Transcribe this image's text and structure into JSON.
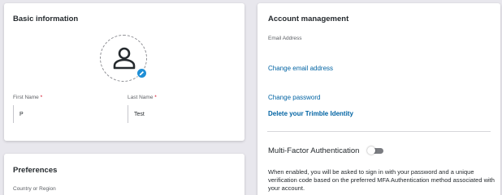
{
  "basic_info": {
    "title": "Basic information",
    "first_name": {
      "label": "First Name",
      "required_mark": "*",
      "value": "P"
    },
    "last_name": {
      "label": "Last Name",
      "required_mark": "*",
      "value": "Test"
    },
    "avatar_icon": "user-outline-icon",
    "edit_icon": "pencil-icon"
  },
  "preferences": {
    "title": "Preferences",
    "country_label": "Country or Region"
  },
  "account": {
    "title": "Account management",
    "email_label": "Email Address",
    "change_email": "Change email address",
    "change_password": "Change password",
    "delete_identity": "Delete your Trimble Identity",
    "mfa": {
      "title": "Multi-Factor Authentication",
      "enabled": false,
      "description": "When enabled, you will be asked to sign in with your password and a unique verification code based on the preferred MFA Authentication method associated with your account."
    }
  },
  "colors": {
    "link": "#0063a3",
    "required": "#d0021b",
    "edit_badge": "#1f8fd6",
    "background": "#e8e7ed"
  }
}
